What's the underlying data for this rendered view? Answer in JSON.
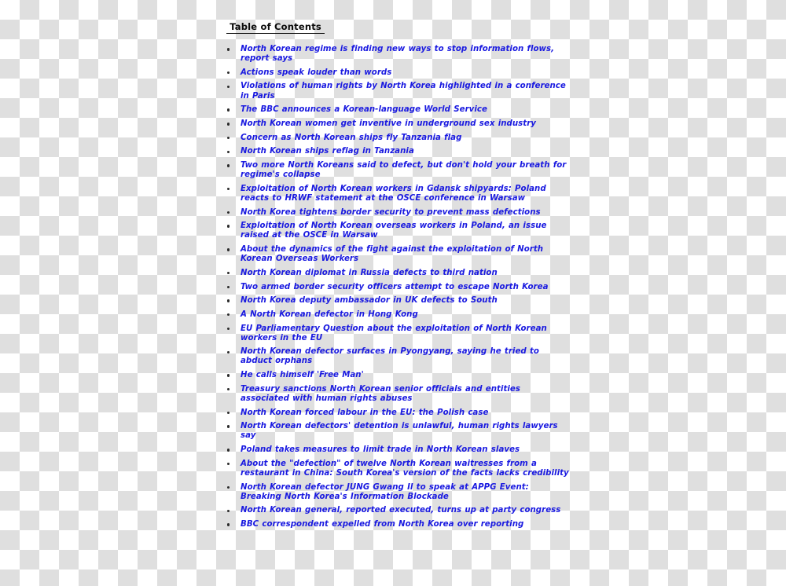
{
  "document": {
    "title": " Table of Contents ",
    "title_color": "#0a0a0a",
    "link_color": "#1a1ae0",
    "bullet_color": "#2b2b2b",
    "background": "transparency-checkerboard",
    "checker_colors": [
      "#ffffff",
      "#dfdfdf"
    ]
  },
  "toc": {
    "items": [
      {
        "text": "North Korean regime is finding new ways to stop information flows, report says"
      },
      {
        "text": "Actions speak louder than words"
      },
      {
        "text": "Violations of human rights by North Korea highlighted in a conference in Paris"
      },
      {
        "text": "The BBC announces a Korean-language World Service"
      },
      {
        "text": "North Korean women get inventive in underground sex industry"
      },
      {
        "text": "Concern as North Korean ships fly Tanzania flag"
      },
      {
        "text": "North Korean ships reflag in Tanzania"
      },
      {
        "text": "Two more North Koreans said to defect, but don't hold your breath for regime's collapse"
      },
      {
        "text": "Exploitation of North Korean workers in Gdansk shipyards: Poland reacts to HRWF statement at the OSCE conference in Warsaw"
      },
      {
        "text": "North Korea tightens border security to prevent mass defections"
      },
      {
        "text": "Exploitation of North Korean overseas workers in Poland, an issue raised at the OSCE in Warsaw"
      },
      {
        "text": "About the dynamics of the fight against the exploitation of North Korean Overseas Workers"
      },
      {
        "text": "North Korean diplomat in Russia defects to third nation"
      },
      {
        "text": "Two armed border security officers attempt to escape North Korea"
      },
      {
        "text": "North Korea deputy ambassador in UK defects to South"
      },
      {
        "text": "A North Korean defector in Hong Kong"
      },
      {
        "text": "EU Parliamentary Question about the exploitation of North Korean workers in the EU"
      },
      {
        "text": "North Korean defector surfaces in Pyongyang, saying he tried to abduct orphans"
      },
      {
        "text": "He calls himself 'Free Man'"
      },
      {
        "text": "Treasury sanctions North Korean senior officials and entities associated with human rights abuses"
      },
      {
        "text": "North Korean forced labour in the EU: the Polish case"
      },
      {
        "text": "North Korean defectors' detention is unlawful, human rights lawyers say"
      },
      {
        "text": "Poland takes measures to limit trade in North Korean slaves"
      },
      {
        "text": "About the \"defection\" of twelve North Korean waitresses from a restaurant in China: South Korea's version of the facts lacks credibility"
      },
      {
        "text": "North Korean defector JUNG Gwang Il to speak at APPG Event: Breaking North Korea's Information Blockade"
      },
      {
        "text": "North Korean general, reported executed, turns up at party congress"
      },
      {
        "text": "BBC correspondent expelled from North Korea over reporting"
      }
    ]
  }
}
